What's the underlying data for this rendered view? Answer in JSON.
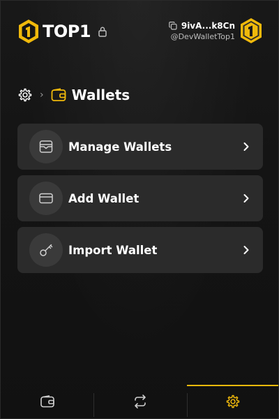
{
  "header": {
    "brand": "TOP1",
    "account": {
      "address": "9ivA...k8Cn",
      "handle": "@DevWalletTop1"
    }
  },
  "breadcrumb": {
    "title": "Wallets"
  },
  "menu": {
    "items": [
      {
        "label": "Manage Wallets",
        "icon": "wallet-envelope-icon"
      },
      {
        "label": "Add Wallet",
        "icon": "card-icon"
      },
      {
        "label": "Import Wallet",
        "icon": "key-icon"
      }
    ]
  },
  "bottom_nav": {
    "tabs": [
      {
        "icon": "wallet-icon",
        "active": false
      },
      {
        "icon": "swap-icon",
        "active": false
      },
      {
        "icon": "settings-icon",
        "active": true
      }
    ]
  },
  "colors": {
    "accent": "#f0b90b",
    "card": "#2b2b2b",
    "background": "#141414"
  }
}
